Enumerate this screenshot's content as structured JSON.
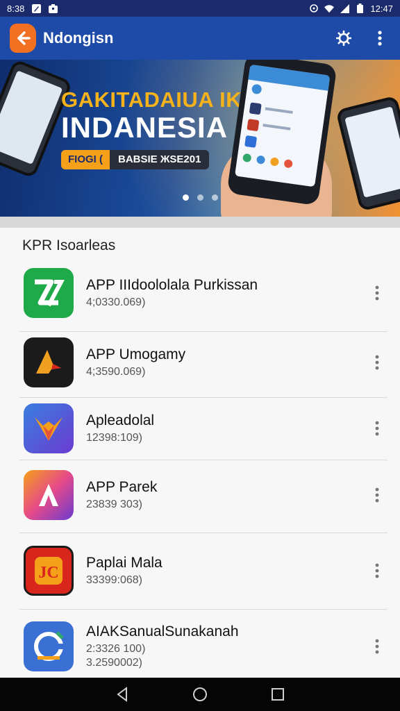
{
  "status_bar": {
    "time": "8:38",
    "clock_right": "12:47",
    "icons": [
      "edit-icon",
      "briefcase-icon",
      "vibrate-icon",
      "wifi-icon",
      "signal-icon",
      "battery-icon"
    ]
  },
  "app_bar": {
    "title": "Ndongisn",
    "accent": "#1f4ba8",
    "logo_color": "#f36f21",
    "icons": [
      "back-arrow-icon",
      "settings-gear-icon",
      "more-vert-icon"
    ]
  },
  "banner": {
    "headline": "GAKITADAIUA IKK",
    "subhead": "INDANESIA",
    "promo_a": "FIOGI (",
    "promo_b": "BABSIE ЖSE201",
    "slides": 3,
    "active_slide": 0
  },
  "list": {
    "title": "KPR Isoarleas",
    "items": [
      {
        "name": "APP IIIdoololala Purkissan",
        "meta": [
          "4;0330.069)"
        ],
        "icon_bg": "#1faa4a",
        "icon_glyph": "Z"
      },
      {
        "name": "APP Umogamy",
        "meta": [
          "4;3590.069)"
        ],
        "icon_bg": "#1b1b1b",
        "icon_glyph": "A"
      },
      {
        "name": "Apleadolal",
        "meta": [
          "12398:109)"
        ],
        "icon_bg": "#2f6fd8",
        "icon_glyph": "V"
      },
      {
        "name": "APP Parek",
        "meta": [
          "23839 303)"
        ],
        "icon_bg": "#e64a8a",
        "icon_glyph": "A"
      },
      {
        "name": "Paplai Mala",
        "meta": [
          "33399:068)"
        ],
        "icon_bg": "#d9261c",
        "icon_glyph": "JC"
      },
      {
        "name": "AIAKSanualSunakanah",
        "meta": [
          "2:3326 100)",
          "3.2590002)"
        ],
        "icon_bg": "#3a6fd4",
        "icon_glyph": "G"
      }
    ]
  },
  "nav": {
    "icons": [
      "nav-back-icon",
      "nav-home-icon",
      "nav-recents-icon"
    ]
  }
}
